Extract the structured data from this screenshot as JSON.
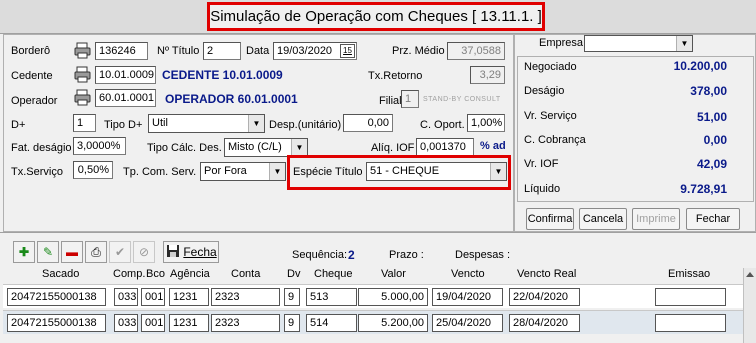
{
  "window": {
    "title": "Simulação de Operação com Cheques [ 13.11.1. ]"
  },
  "form": {
    "bordero_label": "Borderô",
    "bordero_value": "136246",
    "num_titulo_label": "Nº Título",
    "num_titulo_value": "2",
    "data_label": "Data",
    "data_value": "19/03/2020",
    "calendar_button": "15",
    "prz_medio_label": "Prz. Médio",
    "prz_medio_value": "37,0588",
    "cedente_label": "Cedente",
    "cedente_code": "10.01.0009",
    "cedente_name": "CEDENTE 10.01.0009",
    "tx_retorno_label": "Tx.Retorno",
    "tx_retorno_value": "3,29",
    "operador_label": "Operador",
    "operador_code": "60.01.0001",
    "operador_name": "OPERADOR 60.01.0001",
    "filial_label": "Filial",
    "filial_value": "1",
    "filial_name": "STAND-BY CONSULT",
    "dplus_label": "D+",
    "dplus_value": "1",
    "tipo_dplus_label": "Tipo D+",
    "tipo_dplus_value": "Util",
    "desp_label": "Desp.(unitário)",
    "desp_value": "0,00",
    "c_oport_label": "C. Oport.",
    "c_oport_value": "1,00%",
    "fat_desagio_label": "Fat. deságio",
    "fat_desagio_value": "3,0000%",
    "tipo_calc_label": "Tipo Cálc. Des.",
    "tipo_calc_value": "Misto (C/L)",
    "aliq_iof_label": "Alíq. IOF",
    "aliq_iof_value": "0,001370",
    "aliq_iof_suffix": "% ad",
    "tx_servico_label": "Tx.Serviço",
    "tx_servico_value": "0,50%",
    "tp_com_serv_label": "Tp. Com. Serv.",
    "tp_com_serv_value": "Por Fora",
    "especie_label": "Espécie Título",
    "especie_value": "51 - CHEQUE"
  },
  "summary": {
    "empresa_label": "Empresa",
    "empresa_value": "",
    "rows": [
      {
        "label": "Negociado",
        "value": "10.200,00"
      },
      {
        "label": "Deságio",
        "value": "378,00"
      },
      {
        "label": "Vr. Serviço",
        "value": "51,00"
      },
      {
        "label": "C. Cobrança",
        "value": "0,00"
      },
      {
        "label": "Vr. IOF",
        "value": "42,09"
      },
      {
        "label": "Líquido",
        "value": "9.728,91"
      }
    ],
    "buttons": {
      "confirma": "Confirma",
      "cancela": "Cancela",
      "imprime": "Imprime",
      "fechar": "Fechar"
    }
  },
  "toolbar": {
    "fecha_label": "Fecha",
    "sequencia_label": "Sequência:",
    "sequencia_value": "2",
    "prazo_label": "Prazo :",
    "despesas_label": "Despesas :"
  },
  "grid": {
    "headers": [
      "Sacado",
      "Comp.",
      "Bco",
      "Agência",
      "Conta",
      "Dv",
      "Cheque",
      "Valor",
      "Vencto",
      "Vencto Real",
      "Emissao"
    ],
    "rows": [
      [
        "20472155000138",
        "033",
        "001",
        "1231",
        "2323",
        "9",
        "513",
        "5.000,00",
        "19/04/2020",
        "22/04/2020",
        ""
      ],
      [
        "20472155000138",
        "033",
        "001",
        "1231",
        "2323",
        "9",
        "514",
        "5.200,00",
        "25/04/2020",
        "28/04/2020",
        ""
      ]
    ]
  },
  "colors": {
    "highlight": "#e00000",
    "value_blue": "#0a1a8a"
  }
}
